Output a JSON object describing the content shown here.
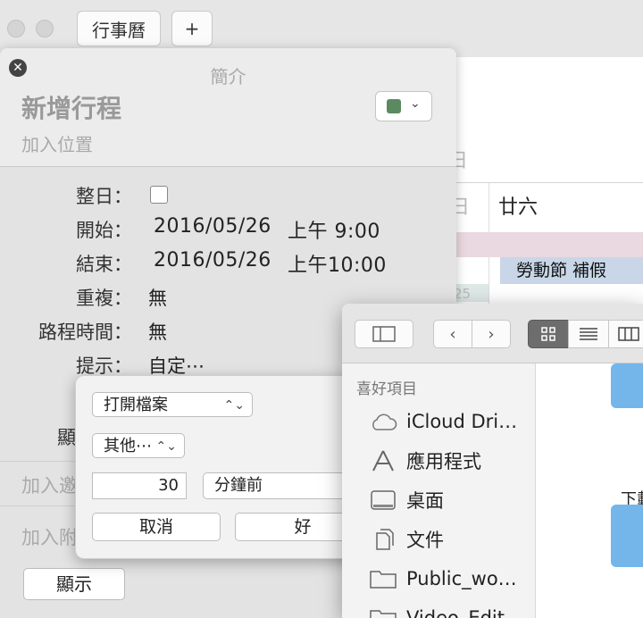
{
  "calendar": {
    "tab_label": "行事曆",
    "add_label": "+",
    "big_glyph": "]",
    "day_label": "日",
    "day_partial": "日",
    "column_head": "廿六",
    "event_title": "勞動節 補假",
    "cell_number": "25"
  },
  "event_popover": {
    "header": "簡介",
    "title": "新增行程",
    "location_placeholder": "加入位置",
    "color": "#5a8a60",
    "rows": {
      "all_day_label": "整日：",
      "start_label": "開始：",
      "start_date": "2016/05/26",
      "start_time": "上午 9:00",
      "end_label": "結束：",
      "end_date": "2016/05/26",
      "end_time": "上午10:00",
      "repeat_label": "重複：",
      "repeat_value": "無",
      "travel_label": "路程時間：",
      "travel_value": "無",
      "alert_label": "提示：",
      "alert_value": "自定⋯",
      "show_partial": "顯"
    },
    "add_invitee_partial": "加入邀",
    "add_attachment_partial": "加入附",
    "show_button": "顯示"
  },
  "alert_sheet": {
    "action_popup": "打開檔案",
    "file_popup": "其他⋯",
    "amount": "30",
    "unit": "分鐘前",
    "cancel": "取消",
    "ok": "好"
  },
  "finder": {
    "sidebar_header": "喜好項目",
    "items": [
      {
        "label": "iCloud Dri…",
        "icon": "cloud-icon"
      },
      {
        "label": "應用程式",
        "icon": "applications-icon"
      },
      {
        "label": "桌面",
        "icon": "desktop-icon"
      },
      {
        "label": "文件",
        "icon": "documents-icon"
      },
      {
        "label": "Public_wo…",
        "icon": "folder-icon"
      },
      {
        "label": "Video_Edit…",
        "icon": "folder-icon"
      }
    ],
    "main_label_partial": "下載"
  }
}
